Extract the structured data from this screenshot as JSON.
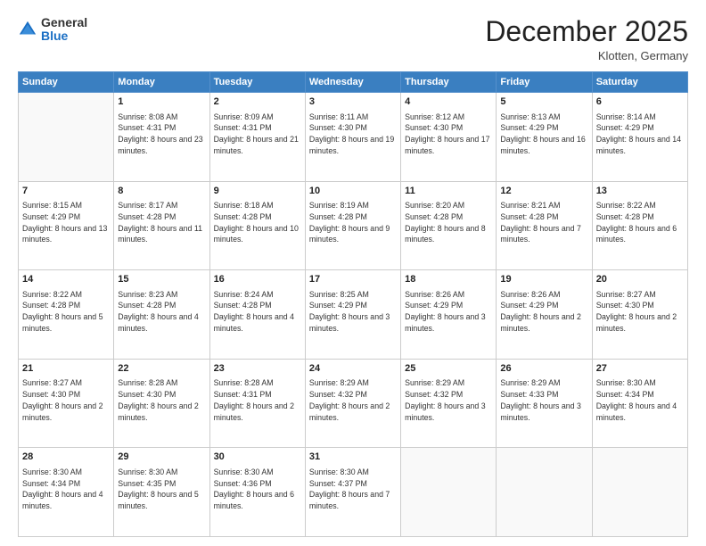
{
  "header": {
    "logo": {
      "general": "General",
      "blue": "Blue"
    },
    "title": "December 2025",
    "location": "Klotten, Germany"
  },
  "days_of_week": [
    "Sunday",
    "Monday",
    "Tuesday",
    "Wednesday",
    "Thursday",
    "Friday",
    "Saturday"
  ],
  "weeks": [
    [
      {
        "day": null,
        "sunrise": null,
        "sunset": null,
        "daylight": null
      },
      {
        "day": "1",
        "sunrise": "Sunrise: 8:08 AM",
        "sunset": "Sunset: 4:31 PM",
        "daylight": "Daylight: 8 hours and 23 minutes."
      },
      {
        "day": "2",
        "sunrise": "Sunrise: 8:09 AM",
        "sunset": "Sunset: 4:31 PM",
        "daylight": "Daylight: 8 hours and 21 minutes."
      },
      {
        "day": "3",
        "sunrise": "Sunrise: 8:11 AM",
        "sunset": "Sunset: 4:30 PM",
        "daylight": "Daylight: 8 hours and 19 minutes."
      },
      {
        "day": "4",
        "sunrise": "Sunrise: 8:12 AM",
        "sunset": "Sunset: 4:30 PM",
        "daylight": "Daylight: 8 hours and 17 minutes."
      },
      {
        "day": "5",
        "sunrise": "Sunrise: 8:13 AM",
        "sunset": "Sunset: 4:29 PM",
        "daylight": "Daylight: 8 hours and 16 minutes."
      },
      {
        "day": "6",
        "sunrise": "Sunrise: 8:14 AM",
        "sunset": "Sunset: 4:29 PM",
        "daylight": "Daylight: 8 hours and 14 minutes."
      }
    ],
    [
      {
        "day": "7",
        "sunrise": "Sunrise: 8:15 AM",
        "sunset": "Sunset: 4:29 PM",
        "daylight": "Daylight: 8 hours and 13 minutes."
      },
      {
        "day": "8",
        "sunrise": "Sunrise: 8:17 AM",
        "sunset": "Sunset: 4:28 PM",
        "daylight": "Daylight: 8 hours and 11 minutes."
      },
      {
        "day": "9",
        "sunrise": "Sunrise: 8:18 AM",
        "sunset": "Sunset: 4:28 PM",
        "daylight": "Daylight: 8 hours and 10 minutes."
      },
      {
        "day": "10",
        "sunrise": "Sunrise: 8:19 AM",
        "sunset": "Sunset: 4:28 PM",
        "daylight": "Daylight: 8 hours and 9 minutes."
      },
      {
        "day": "11",
        "sunrise": "Sunrise: 8:20 AM",
        "sunset": "Sunset: 4:28 PM",
        "daylight": "Daylight: 8 hours and 8 minutes."
      },
      {
        "day": "12",
        "sunrise": "Sunrise: 8:21 AM",
        "sunset": "Sunset: 4:28 PM",
        "daylight": "Daylight: 8 hours and 7 minutes."
      },
      {
        "day": "13",
        "sunrise": "Sunrise: 8:22 AM",
        "sunset": "Sunset: 4:28 PM",
        "daylight": "Daylight: 8 hours and 6 minutes."
      }
    ],
    [
      {
        "day": "14",
        "sunrise": "Sunrise: 8:22 AM",
        "sunset": "Sunset: 4:28 PM",
        "daylight": "Daylight: 8 hours and 5 minutes."
      },
      {
        "day": "15",
        "sunrise": "Sunrise: 8:23 AM",
        "sunset": "Sunset: 4:28 PM",
        "daylight": "Daylight: 8 hours and 4 minutes."
      },
      {
        "day": "16",
        "sunrise": "Sunrise: 8:24 AM",
        "sunset": "Sunset: 4:28 PM",
        "daylight": "Daylight: 8 hours and 4 minutes."
      },
      {
        "day": "17",
        "sunrise": "Sunrise: 8:25 AM",
        "sunset": "Sunset: 4:29 PM",
        "daylight": "Daylight: 8 hours and 3 minutes."
      },
      {
        "day": "18",
        "sunrise": "Sunrise: 8:26 AM",
        "sunset": "Sunset: 4:29 PM",
        "daylight": "Daylight: 8 hours and 3 minutes."
      },
      {
        "day": "19",
        "sunrise": "Sunrise: 8:26 AM",
        "sunset": "Sunset: 4:29 PM",
        "daylight": "Daylight: 8 hours and 2 minutes."
      },
      {
        "day": "20",
        "sunrise": "Sunrise: 8:27 AM",
        "sunset": "Sunset: 4:30 PM",
        "daylight": "Daylight: 8 hours and 2 minutes."
      }
    ],
    [
      {
        "day": "21",
        "sunrise": "Sunrise: 8:27 AM",
        "sunset": "Sunset: 4:30 PM",
        "daylight": "Daylight: 8 hours and 2 minutes."
      },
      {
        "day": "22",
        "sunrise": "Sunrise: 8:28 AM",
        "sunset": "Sunset: 4:30 PM",
        "daylight": "Daylight: 8 hours and 2 minutes."
      },
      {
        "day": "23",
        "sunrise": "Sunrise: 8:28 AM",
        "sunset": "Sunset: 4:31 PM",
        "daylight": "Daylight: 8 hours and 2 minutes."
      },
      {
        "day": "24",
        "sunrise": "Sunrise: 8:29 AM",
        "sunset": "Sunset: 4:32 PM",
        "daylight": "Daylight: 8 hours and 2 minutes."
      },
      {
        "day": "25",
        "sunrise": "Sunrise: 8:29 AM",
        "sunset": "Sunset: 4:32 PM",
        "daylight": "Daylight: 8 hours and 3 minutes."
      },
      {
        "day": "26",
        "sunrise": "Sunrise: 8:29 AM",
        "sunset": "Sunset: 4:33 PM",
        "daylight": "Daylight: 8 hours and 3 minutes."
      },
      {
        "day": "27",
        "sunrise": "Sunrise: 8:30 AM",
        "sunset": "Sunset: 4:34 PM",
        "daylight": "Daylight: 8 hours and 4 minutes."
      }
    ],
    [
      {
        "day": "28",
        "sunrise": "Sunrise: 8:30 AM",
        "sunset": "Sunset: 4:34 PM",
        "daylight": "Daylight: 8 hours and 4 minutes."
      },
      {
        "day": "29",
        "sunrise": "Sunrise: 8:30 AM",
        "sunset": "Sunset: 4:35 PM",
        "daylight": "Daylight: 8 hours and 5 minutes."
      },
      {
        "day": "30",
        "sunrise": "Sunrise: 8:30 AM",
        "sunset": "Sunset: 4:36 PM",
        "daylight": "Daylight: 8 hours and 6 minutes."
      },
      {
        "day": "31",
        "sunrise": "Sunrise: 8:30 AM",
        "sunset": "Sunset: 4:37 PM",
        "daylight": "Daylight: 8 hours and 7 minutes."
      },
      {
        "day": null,
        "sunrise": null,
        "sunset": null,
        "daylight": null
      },
      {
        "day": null,
        "sunrise": null,
        "sunset": null,
        "daylight": null
      },
      {
        "day": null,
        "sunrise": null,
        "sunset": null,
        "daylight": null
      }
    ]
  ]
}
